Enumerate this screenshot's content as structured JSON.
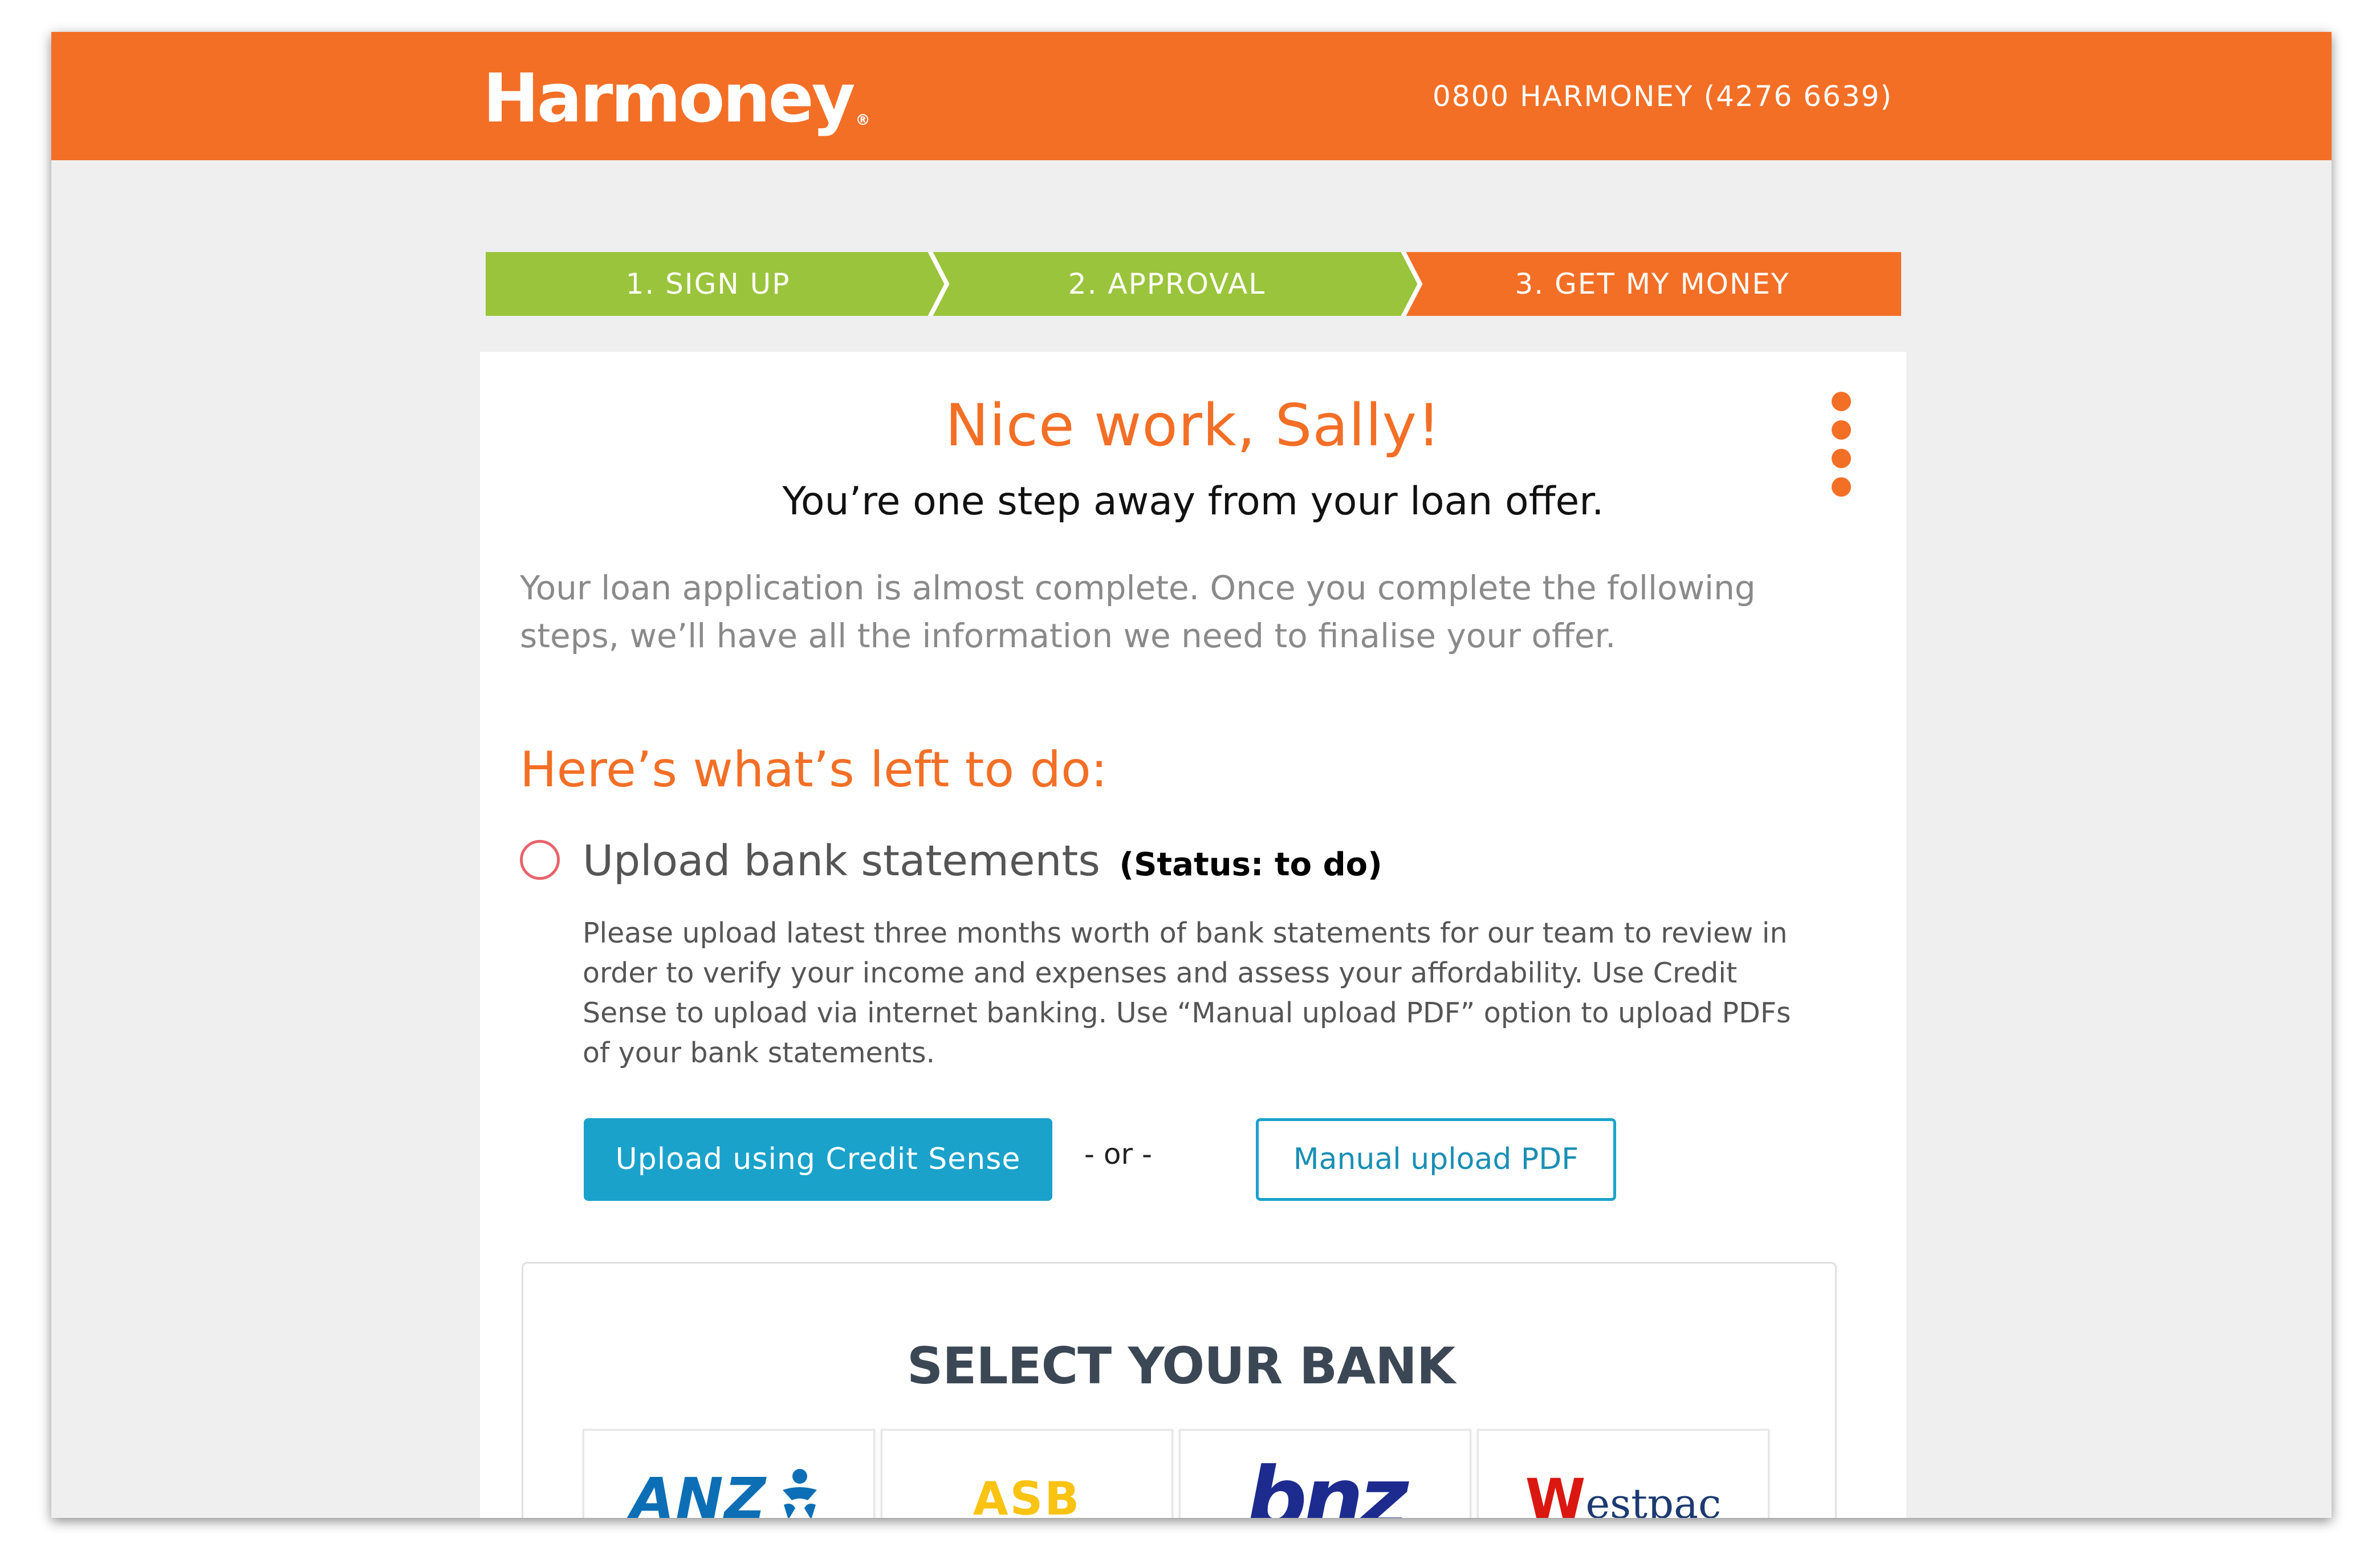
{
  "header": {
    "logo_text": "Harmoney",
    "logo_reg": "®",
    "phone": "0800 HARMONEY (4276 6639)"
  },
  "steps": [
    {
      "label": "1. SIGN UP",
      "state": "complete"
    },
    {
      "label": "2. APPROVAL",
      "state": "complete"
    },
    {
      "label": "3. GET MY MONEY",
      "state": "current"
    }
  ],
  "card": {
    "greeting": "Nice work, Sally!",
    "subgreeting": "You’re one step away from your loan offer.",
    "intro": "Your loan application is almost complete. Once you complete the following steps, we’ll have all the information we need to finalise your offer.",
    "todo_heading": "Here’s what’s left to do:",
    "task": {
      "title": "Upload bank statements",
      "status": "(Status: to do)",
      "description": "Please upload latest three months worth of bank statements for our team to review in order to verify your income and expenses and assess your affordability. Use Credit Sense to upload via internet banking. Use “Manual upload PDF” option to upload PDFs of your bank statements."
    },
    "buttons": {
      "credit_sense": "Upload using Credit Sense",
      "separator": "- or -",
      "manual_pdf": "Manual upload PDF"
    },
    "bank_select": {
      "heading": "SELECT YOUR BANK",
      "banks": [
        {
          "name": "ANZ",
          "icon": "anz-logo"
        },
        {
          "name": "ASB",
          "icon": "asb-logo"
        },
        {
          "name": "bnz",
          "icon": "bnz-logo"
        },
        {
          "name": "estpac",
          "mark": "W",
          "icon": "westpac-logo"
        }
      ]
    }
  },
  "colors": {
    "brand_orange": "#f36f26",
    "step_complete_green": "#9ac43c",
    "button_blue": "#1aa2cb",
    "status_circle": "#e8636b"
  }
}
